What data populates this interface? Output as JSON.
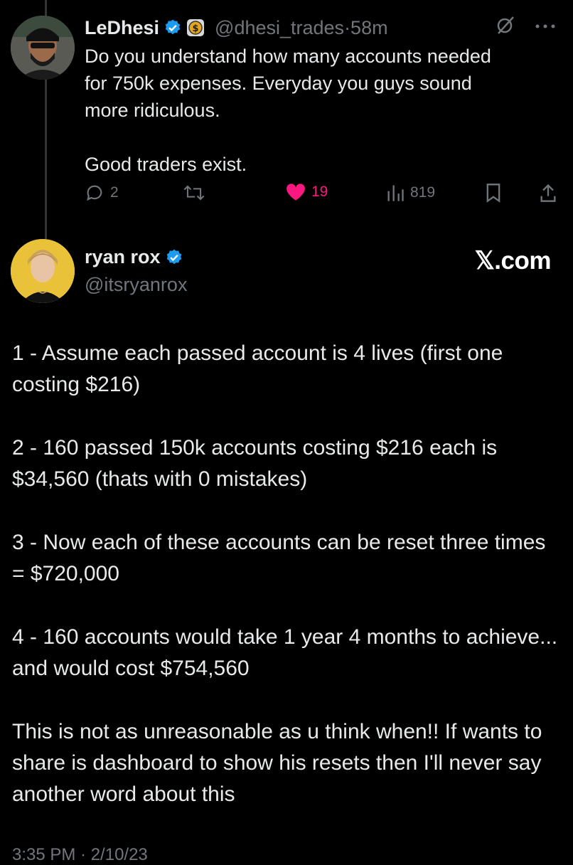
{
  "tweet1": {
    "name": "LeDhesi",
    "handle": "@dhesi_trades",
    "time": "·58m",
    "lines": [
      "Do you understand how many accounts needed",
      "for 750k expenses. Everyday you guys sound",
      "more ridiculous.",
      "Good traders exist."
    ],
    "replies": "2",
    "likes": "19",
    "views": "819"
  },
  "tweet2": {
    "name": "ryan rox",
    "handle": "@itsryanrox",
    "watermark": "𝕏.com",
    "paragraphs": [
      "1 - Assume each passed account is 4 lives (first one costing $216)",
      "2 - 160 passed 150k  accounts costing $216 each is $34,560 (thats with 0 mistakes)",
      "3 - Now each of these accounts can be reset three times = $720,000",
      "4 - 160 accounts would take 1 year 4 months to achieve... and would cost $754,560",
      "This is not as unreasonable as u think when!! If wants to share is dashboard to show his resets then I'll never say another word about this"
    ],
    "footer": "3:35 PM · 2/10/23"
  },
  "colors": {
    "background": "#000000",
    "text": "#e7e9ea",
    "muted": "#71767b",
    "verified": "#1d9bf0",
    "like": "#f91880"
  }
}
